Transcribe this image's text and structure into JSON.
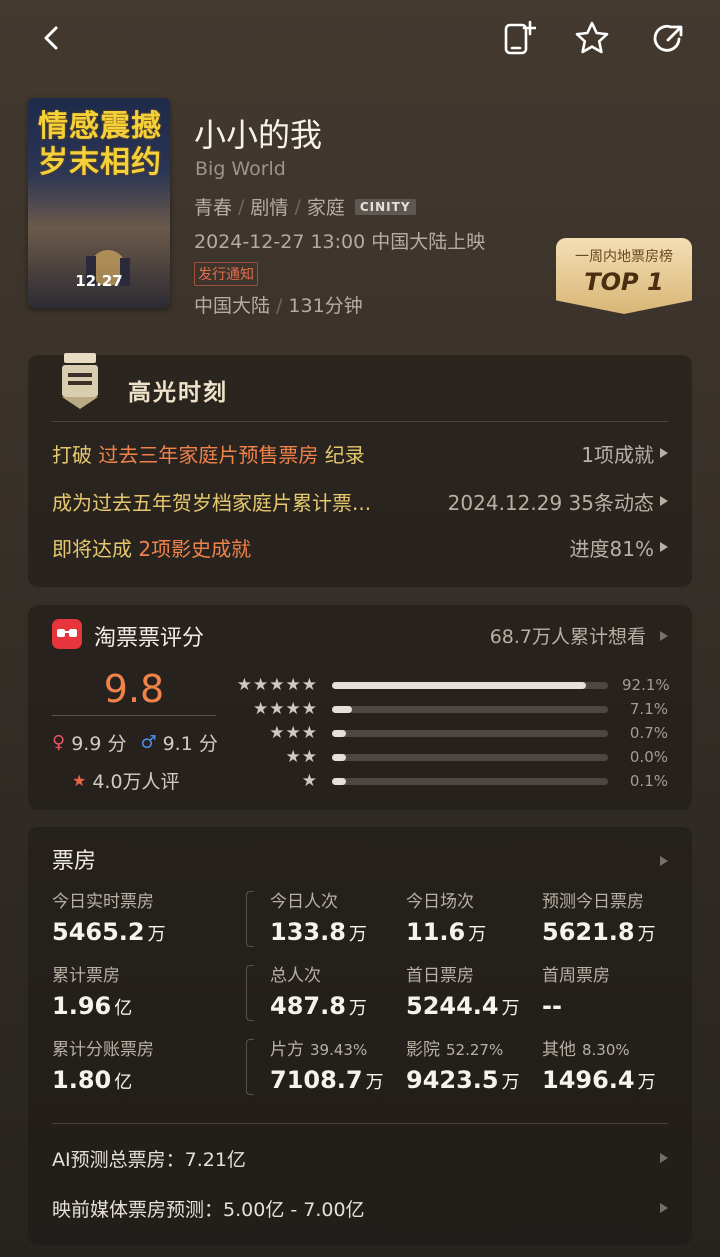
{
  "nav": {
    "back_icon": "chevron-left-icon",
    "icons": [
      "add-to-phone-icon",
      "star-outline-icon",
      "share-icon"
    ]
  },
  "movie": {
    "poster_text": [
      "情感震撼",
      "岁末相约"
    ],
    "poster_date": "12.27",
    "title": "小小的我",
    "english_title": "Big World",
    "genres": [
      "青春",
      "剧情",
      "家庭"
    ],
    "format_badge": "CINITY",
    "release": "2024-12-27 13:00 中国大陆上映",
    "release_tag": "发行通知",
    "region": "中国大陆",
    "runtime": "131分钟"
  },
  "rank_badge": {
    "label": "一周内地票房榜",
    "value": "TOP 1"
  },
  "highlights": {
    "title": "高光时刻",
    "rows": [
      {
        "prefix": "打破 ",
        "highlight": "过去三年家庭片预售票房",
        "suffix": " 纪录",
        "right": "1项成就"
      },
      {
        "prefix": "成为过去五年贺岁档家庭片累计票...",
        "highlight": "",
        "suffix": "",
        "right": "2024.12.29  35条动态"
      },
      {
        "prefix": "即将达成 ",
        "highlight": "2项影史成就",
        "suffix": "",
        "right": "进度81%"
      }
    ]
  },
  "rating": {
    "title": "淘票票评分",
    "want_count": "68.7万人累计想看",
    "score": "9.8",
    "female_score": "9.9 分",
    "male_score": "9.1 分",
    "rating_count": "4.0万人评",
    "distribution": [
      {
        "stars": "★★★★★",
        "value": 92.1,
        "label": "92.1%"
      },
      {
        "stars": "★★★★",
        "value": 7.1,
        "label": "7.1%"
      },
      {
        "stars": "★★★",
        "value": 0.7,
        "label": "0.7%"
      },
      {
        "stars": "★★",
        "value": 0.0,
        "label": "0.0%"
      },
      {
        "stars": "★",
        "value": 0.1,
        "label": "0.1%"
      }
    ]
  },
  "box_office": {
    "title": "票房",
    "rows": [
      [
        {
          "label": "今日实时票房",
          "sub": "",
          "value": "5465.2",
          "unit": "万"
        },
        {
          "label": "今日人次",
          "sub": "",
          "value": "133.8",
          "unit": "万"
        },
        {
          "label": "今日场次",
          "sub": "",
          "value": "11.6",
          "unit": "万"
        },
        {
          "label": "预测今日票房",
          "sub": "",
          "value": "5621.8",
          "unit": "万"
        }
      ],
      [
        {
          "label": "累计票房",
          "sub": "",
          "value": "1.96",
          "unit": "亿"
        },
        {
          "label": "总人次",
          "sub": "",
          "value": "487.8",
          "unit": "万"
        },
        {
          "label": "首日票房",
          "sub": "",
          "value": "5244.4",
          "unit": "万"
        },
        {
          "label": "首周票房",
          "sub": "",
          "value": "--",
          "unit": ""
        }
      ],
      [
        {
          "label": "累计分账票房",
          "sub": "",
          "value": "1.80",
          "unit": "亿"
        },
        {
          "label": "片方",
          "sub": "39.43%",
          "value": "7108.7",
          "unit": "万"
        },
        {
          "label": "影院",
          "sub": "52.27%",
          "value": "9423.5",
          "unit": "万"
        },
        {
          "label": "其他",
          "sub": "8.30%",
          "value": "1496.4",
          "unit": "万"
        }
      ]
    ],
    "ai_forecast_label": "AI预测总票房：",
    "ai_forecast_value": "7.21亿",
    "media_forecast_label": "映前媒体票房预测：",
    "media_forecast_value": "5.00亿 - 7.00亿"
  }
}
